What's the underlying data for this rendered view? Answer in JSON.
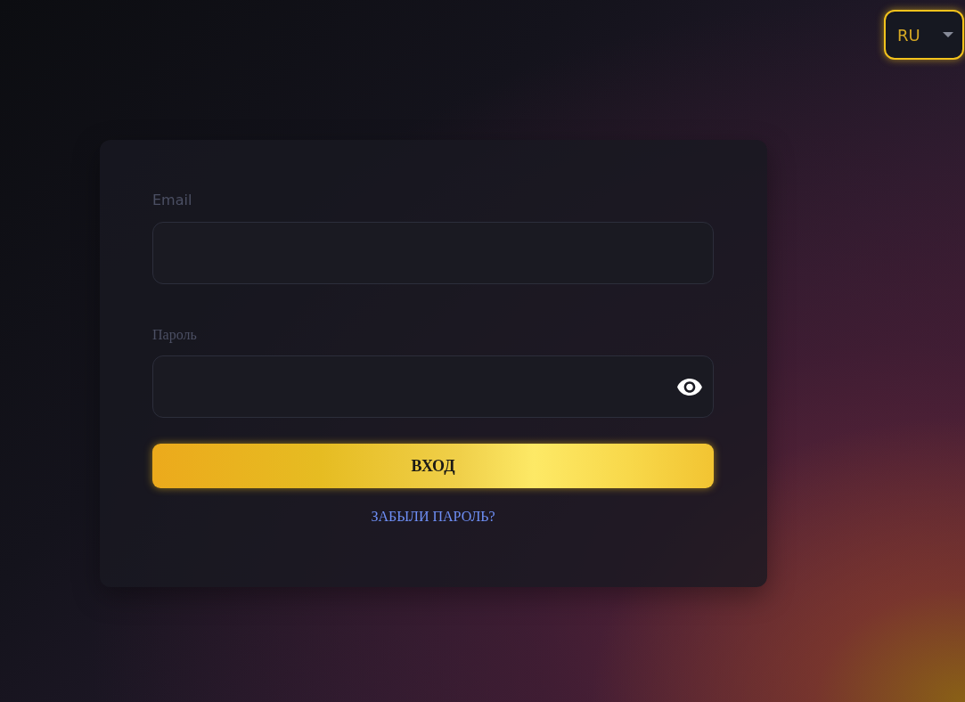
{
  "language_selector": {
    "value": "RU"
  },
  "login_form": {
    "email": {
      "label": "Email"
    },
    "password": {
      "label": "Пароль"
    },
    "submit_button": "ВХОД",
    "forgot_password_link": "ЗАБЫЛИ ПАРОЛЬ?"
  }
}
